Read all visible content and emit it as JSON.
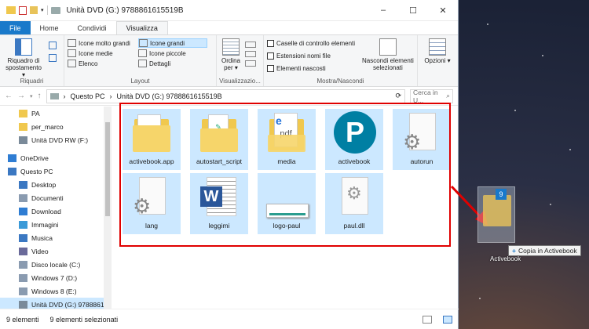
{
  "window": {
    "title": "Unità DVD (G:) 9788861615519B",
    "controls": {
      "minimize": "–",
      "maximize": "☐",
      "close": "✕"
    }
  },
  "tabs": [
    "File",
    "Home",
    "Condividi",
    "Visualizza"
  ],
  "ribbon": {
    "riquadri": {
      "button": "Riquadro di spostamento ▾",
      "label": "Riquadri"
    },
    "layout": {
      "options": [
        "Icone molto grandi",
        "Icone grandi",
        "Icone medie",
        "Icone piccole",
        "Elenco",
        "Dettagli"
      ],
      "selected": "Icone grandi",
      "label": "Layout"
    },
    "visualizzazione": {
      "button": "Ordina per ▾",
      "label": "Visualizzazio..."
    },
    "mostra": {
      "checks": [
        "Caselle di controllo elementi",
        "Estensioni nomi file",
        "Elementi nascosti"
      ],
      "hide_button": "Nascondi elementi selezionati",
      "label": "Mostra/Nascondi"
    },
    "opzioni": {
      "button": "Opzioni ▾"
    }
  },
  "address": {
    "path": [
      "Questo PC",
      "Unità DVD (G:) 9788861615519B"
    ],
    "search_placeholder": "Cerca in U..."
  },
  "nav": [
    {
      "label": "PA",
      "icon": "folder-icon",
      "indent": 1
    },
    {
      "label": "per_marco",
      "icon": "folder-icon",
      "indent": 1
    },
    {
      "label": "Unità DVD RW (F:)",
      "icon": "dvd-drive-icon",
      "indent": 1
    },
    {
      "label": "OneDrive",
      "icon": "onedrive-icon",
      "indent": 0
    },
    {
      "label": "Questo PC",
      "icon": "computer-icon",
      "indent": 0
    },
    {
      "label": "Desktop",
      "icon": "desktop-icon",
      "indent": 1
    },
    {
      "label": "Documenti",
      "icon": "documents-icon",
      "indent": 1
    },
    {
      "label": "Download",
      "icon": "download-icon",
      "indent": 1
    },
    {
      "label": "Immagini",
      "icon": "pictures-icon",
      "indent": 1
    },
    {
      "label": "Musica",
      "icon": "music-icon",
      "indent": 1
    },
    {
      "label": "Video",
      "icon": "video-icon",
      "indent": 1
    },
    {
      "label": "Disco locale (C:)",
      "icon": "disk-icon",
      "indent": 1
    },
    {
      "label": "Windows 7 (D:)",
      "icon": "disk-icon",
      "indent": 1
    },
    {
      "label": "Windows 8 (E:)",
      "icon": "disk-icon",
      "indent": 1
    },
    {
      "label": "Unità DVD (G:) 978886161",
      "icon": "dvd-drive-icon",
      "indent": 1,
      "selected": true
    }
  ],
  "files": [
    {
      "name": "activebook.app",
      "icon": "folder-icon"
    },
    {
      "name": "autostart_script",
      "icon": "folder-script-icon"
    },
    {
      "name": "media",
      "icon": "folder-media-icon"
    },
    {
      "name": "activebook",
      "icon": "pearson-logo-icon"
    },
    {
      "name": "autorun",
      "icon": "settings-file-icon"
    },
    {
      "name": "lang",
      "icon": "settings-file-icon"
    },
    {
      "name": "leggimi",
      "icon": "word-document-icon"
    },
    {
      "name": "logo-paul",
      "icon": "image-file-icon"
    },
    {
      "name": "paul.dll",
      "icon": "dll-file-icon"
    }
  ],
  "status": {
    "count": "9 elementi",
    "selected": "9 elementi selezionati"
  },
  "drag": {
    "tooltip": "Copia in Activebook",
    "target_name": "Activebook",
    "badge": "9"
  },
  "colors": {
    "selection": "#cce8ff",
    "highlight": "#e00000",
    "file_tab": "#1979ca"
  }
}
